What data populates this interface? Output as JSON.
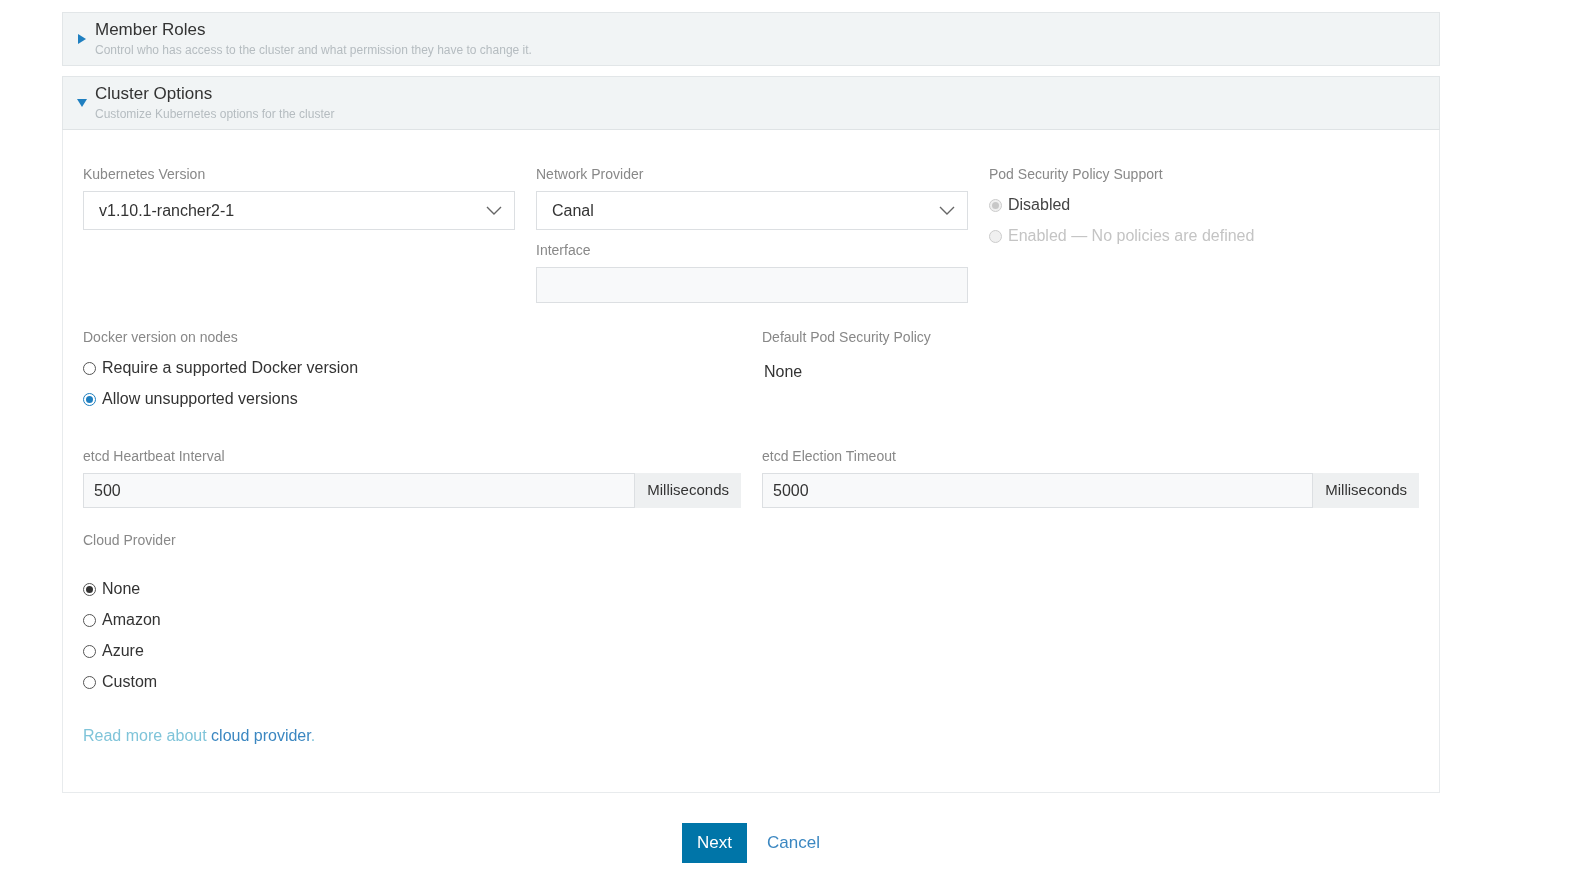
{
  "sections": [
    {
      "title": "Member Roles",
      "description": "Control who has access to the cluster and what permission they have to change it.",
      "expanded": false
    },
    {
      "title": "Cluster Options",
      "description": "Customize Kubernetes options for the cluster",
      "expanded": true
    }
  ],
  "kubernetes_version": {
    "label": "Kubernetes Version",
    "value": "v1.10.1-rancher2-1"
  },
  "network_provider": {
    "label": "Network Provider",
    "value": "Canal"
  },
  "interface": {
    "label": "Interface"
  },
  "pod_security_policy_support": {
    "label": "Pod Security Policy Support",
    "disabled": true,
    "focused": false,
    "options": [
      {
        "label": "Disabled",
        "selected": true
      },
      {
        "label": "Enabled — No policies are defined",
        "selected": false
      }
    ]
  },
  "docker_version": {
    "label": "Docker version on nodes",
    "disabled": false,
    "focused": true,
    "options": [
      {
        "label": "Require a supported Docker version",
        "selected": false
      },
      {
        "label": "Allow unsupported versions",
        "selected": true
      }
    ]
  },
  "default_pod_security_policy": {
    "label": "Default Pod Security Policy",
    "value": "None"
  },
  "etcd_heartbeat_interval": {
    "label": "etcd Heartbeat Interval",
    "value": "500",
    "unit": "Milliseconds"
  },
  "etcd_election_timeout": {
    "label": "etcd Election Timeout",
    "value": "5000",
    "unit": "Milliseconds"
  },
  "cloud_provider": {
    "label": "Cloud Provider",
    "disabled": false,
    "focused": false,
    "options": [
      {
        "label": "None",
        "selected": true
      },
      {
        "label": "Amazon",
        "selected": false
      },
      {
        "label": "Azure",
        "selected": false
      },
      {
        "label": "Custom",
        "selected": false
      }
    ]
  },
  "cloud_provider_help": {
    "prefix": "Read more about",
    "link": "cloud provider",
    "suffix": "."
  },
  "buttons": {
    "next": "Next",
    "cancel": "Cancel"
  }
}
